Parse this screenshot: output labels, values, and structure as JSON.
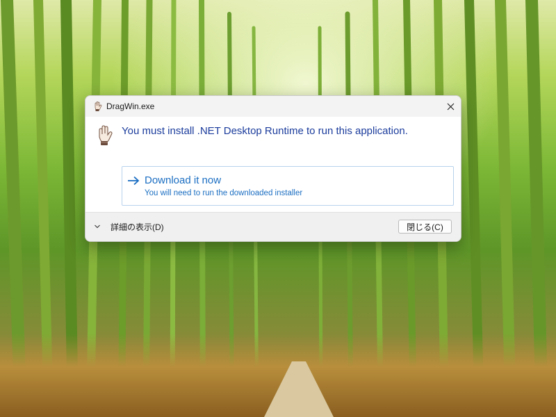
{
  "window": {
    "title": "DragWin.exe",
    "app_icon": "waving-hand-icon",
    "close_icon": "close-icon"
  },
  "dialog": {
    "main_icon": "waving-hand-icon",
    "main_instruction": "You must install .NET Desktop Runtime to run this application.",
    "command_link": {
      "icon": "arrow-right-icon",
      "title": "Download it now",
      "note": "You will need to run the downloaded installer"
    }
  },
  "footer": {
    "details_icon": "chevron-down-icon",
    "details_label": "詳細の表示(D)",
    "close_label": "閉じる(C)"
  },
  "colors": {
    "instruction_text": "#1b3c9c",
    "link_text": "#1b6ec2",
    "link_border": "#b7d2ee",
    "footer_bg": "#f0f0f0"
  }
}
